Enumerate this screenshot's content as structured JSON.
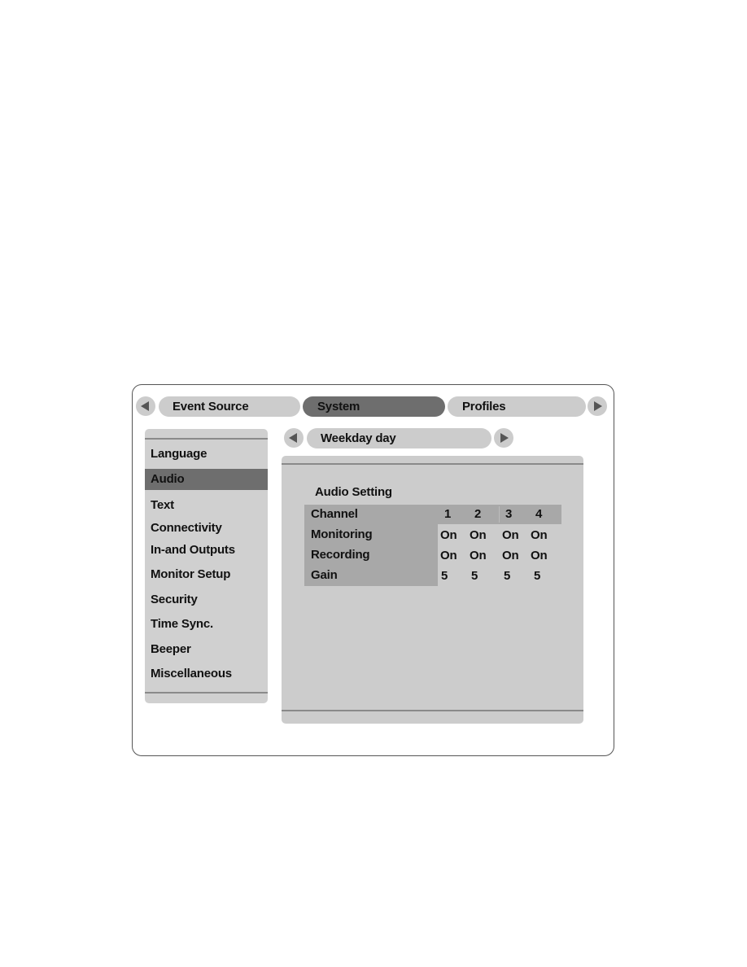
{
  "top_tabs": {
    "prev_icon": "triangle-left-icon",
    "next_icon": "triangle-right-icon",
    "items": [
      {
        "label": "Event Source",
        "active": false
      },
      {
        "label": "System",
        "active": true
      },
      {
        "label": "Profiles",
        "active": false
      }
    ]
  },
  "sub_tab": {
    "label": "Weekday day",
    "prev_icon": "triangle-left-icon",
    "next_icon": "triangle-right-icon"
  },
  "sidebar": {
    "selected": "Audio",
    "items": [
      {
        "label": "Language"
      },
      {
        "label": "Audio"
      },
      {
        "label": "Text"
      },
      {
        "label": "Connectivity"
      },
      {
        "label": "In-and Outputs"
      },
      {
        "label": "Monitor Setup"
      },
      {
        "label": "Security"
      },
      {
        "label": "Time Sync."
      },
      {
        "label": "Beeper"
      },
      {
        "label": "Miscellaneous"
      }
    ]
  },
  "audio_setting": {
    "title": "Audio Setting",
    "header_label": "Channel",
    "channels": [
      "1",
      "2",
      "3",
      "4"
    ],
    "rows": [
      {
        "label": "Monitoring",
        "values": [
          "On",
          "On",
          "On",
          "On"
        ]
      },
      {
        "label": "Recording",
        "values": [
          "On",
          "On",
          "On",
          "On"
        ]
      },
      {
        "label": "Gain",
        "values": [
          "5",
          "5",
          "5",
          "5"
        ]
      }
    ]
  },
  "colors": {
    "active_tab": "#6e6e6e",
    "inactive_tab": "#cccccc",
    "panel_bg": "#cccccc",
    "label_column": "#a8a8a8"
  }
}
